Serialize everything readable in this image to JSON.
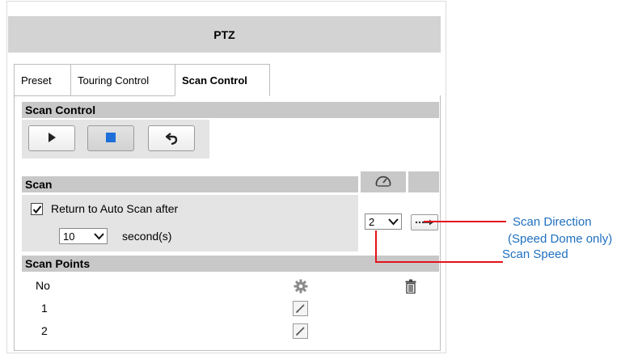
{
  "header": {
    "title": "PTZ"
  },
  "tabs": [
    {
      "label": "Preset",
      "active": false
    },
    {
      "label": "Touring Control",
      "active": false
    },
    {
      "label": "Scan Control",
      "active": true
    }
  ],
  "scan_control": {
    "title": "Scan Control",
    "buttons": [
      {
        "icon": "play-icon"
      },
      {
        "icon": "stop-icon",
        "active": true
      },
      {
        "icon": "return-icon"
      }
    ]
  },
  "scan": {
    "title": "Scan",
    "speed_icon": "speedometer-icon",
    "return_checked": true,
    "return_label": "Return to Auto Scan after",
    "seconds_value": "10",
    "seconds_label": "second(s)",
    "speed_value": "2",
    "direction_icon": "scan-direction-icon"
  },
  "scan_points": {
    "title": "Scan Points",
    "header_no": "No",
    "header_settings_icon": "gear-icon",
    "header_delete_icon": "trash-icon",
    "rows": [
      {
        "no": "1",
        "edit_icon": "edit-icon"
      },
      {
        "no": "2",
        "edit_icon": "edit-icon"
      }
    ]
  },
  "callouts": {
    "direction_line1": "Scan Direction",
    "direction_line2": "(Speed Dome only)",
    "speed": "Scan Speed"
  },
  "colors": {
    "callout_text": "#1f6fbf",
    "callout_line": "#e5121b",
    "stop_icon": "#1e6fd9",
    "section_bar": "#c8c8c8"
  }
}
